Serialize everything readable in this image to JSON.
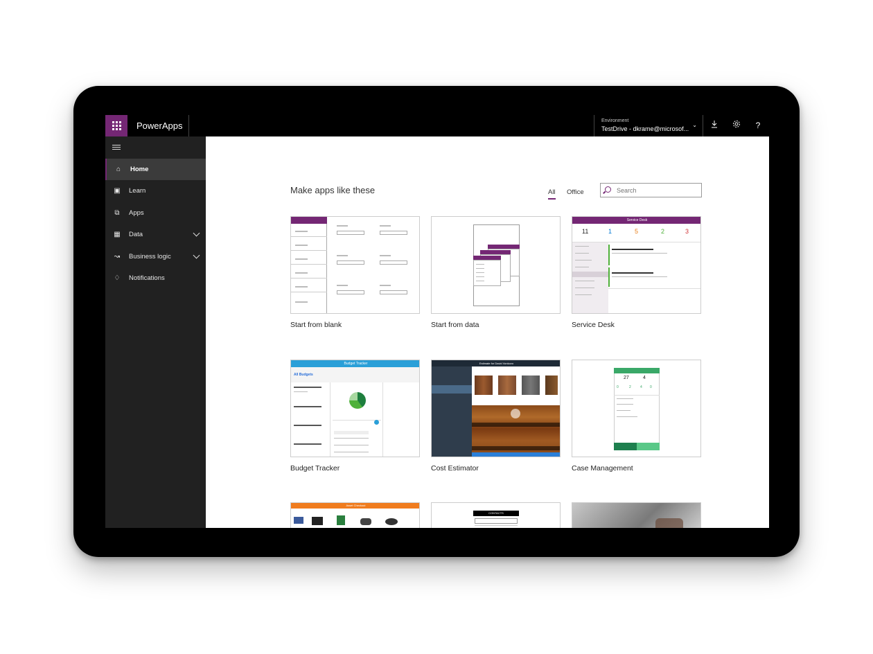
{
  "topbar": {
    "app_name": "PowerApps",
    "environment_label": "Environment",
    "environment_value": "TestDrive - dkrame@microsof...",
    "icons": [
      "waffle-icon",
      "download-icon",
      "settings-icon",
      "help-icon"
    ]
  },
  "sidebar": {
    "items": [
      {
        "label": "Home",
        "icon": "home-icon",
        "active": true
      },
      {
        "label": "Learn",
        "icon": "book-icon"
      },
      {
        "label": "Apps",
        "icon": "apps-icon"
      },
      {
        "label": "Data",
        "icon": "table-icon",
        "expandable": true
      },
      {
        "label": "Business logic",
        "icon": "flow-icon",
        "expandable": true
      },
      {
        "label": "Notifications",
        "icon": "bell-icon"
      }
    ]
  },
  "main": {
    "heading": "Make apps like these",
    "tabs": [
      {
        "label": "All",
        "active": true
      },
      {
        "label": "Office"
      }
    ],
    "search_placeholder": "Search",
    "cards": [
      {
        "title": "Start from blank"
      },
      {
        "title": "Start from data"
      },
      {
        "title": "Service Desk"
      },
      {
        "title": "Budget Tracker"
      },
      {
        "title": "Cost Estimator"
      },
      {
        "title": "Case Management"
      }
    ],
    "thumb_text": {
      "service_desk": "Service Desk",
      "budget_tracker": "Budget Tracker",
      "cost_estimator": "Estimate for David Vonkovo",
      "asset_checkout": "Asset Checkout",
      "contacts": "CONTACTS"
    }
  },
  "colors": {
    "accent": "#742774",
    "topbar_bg": "#000000",
    "sidebar_bg": "#212121"
  }
}
